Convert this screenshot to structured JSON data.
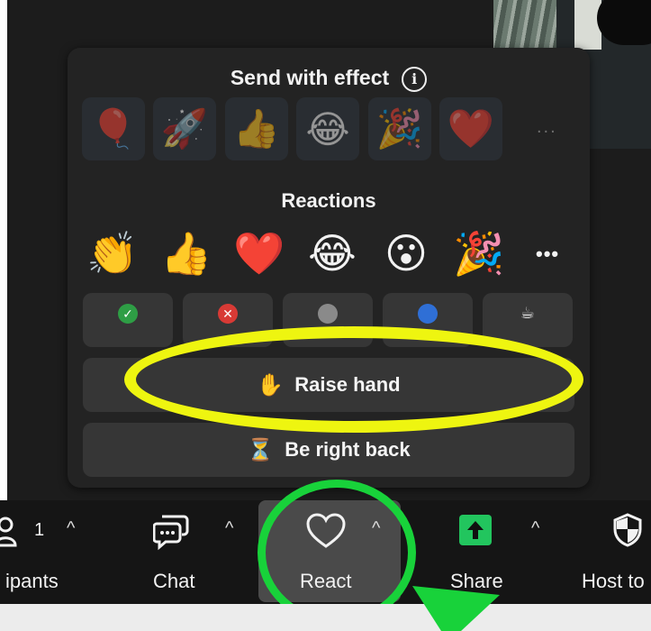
{
  "effects": {
    "title": "Send with effect",
    "info_icon": "info-icon",
    "items": [
      {
        "name": "balloon",
        "glyph": "🎈"
      },
      {
        "name": "rocket",
        "glyph": "🚀"
      },
      {
        "name": "thumbs-up",
        "glyph": "👍"
      },
      {
        "name": "laughing",
        "glyph": "😂"
      },
      {
        "name": "party-popper",
        "glyph": "🎉"
      },
      {
        "name": "heart",
        "glyph": "❤️"
      }
    ],
    "more": "..."
  },
  "reactions": {
    "title": "Reactions",
    "items": [
      {
        "name": "clapping",
        "glyph": "👏"
      },
      {
        "name": "thumbs-up",
        "glyph": "👍"
      },
      {
        "name": "heart",
        "glyph": "❤️"
      },
      {
        "name": "laughing",
        "glyph": "😂"
      },
      {
        "name": "surprised",
        "glyph": "😮"
      },
      {
        "name": "party-popper",
        "glyph": "🎉"
      }
    ],
    "more": "•••"
  },
  "status": {
    "items": [
      {
        "name": "yes",
        "glyph": "✓",
        "color": "#2e9e45"
      },
      {
        "name": "no",
        "glyph": "✕",
        "color": "#d83a35"
      },
      {
        "name": "slower",
        "glyph": "",
        "color": "#8a8a8a"
      },
      {
        "name": "faster",
        "glyph": "",
        "color": "#2f6fd6"
      },
      {
        "name": "coffee",
        "glyph": "☕",
        "color": ""
      }
    ]
  },
  "raise_hand": {
    "emoji": "✋",
    "label": "Raise hand"
  },
  "be_right_back": {
    "emoji": "⏳",
    "label": "Be right back"
  },
  "toolbar": {
    "participants": {
      "count": "1",
      "label": "ipants"
    },
    "chat": {
      "label": "Chat"
    },
    "react": {
      "label": "React"
    },
    "share": {
      "label": "Share"
    },
    "host_tools": {
      "label": "Host to"
    }
  },
  "colors": {
    "highlight_yellow": "#eef510",
    "highlight_green": "#18d23a",
    "share_green": "#22c55e"
  }
}
